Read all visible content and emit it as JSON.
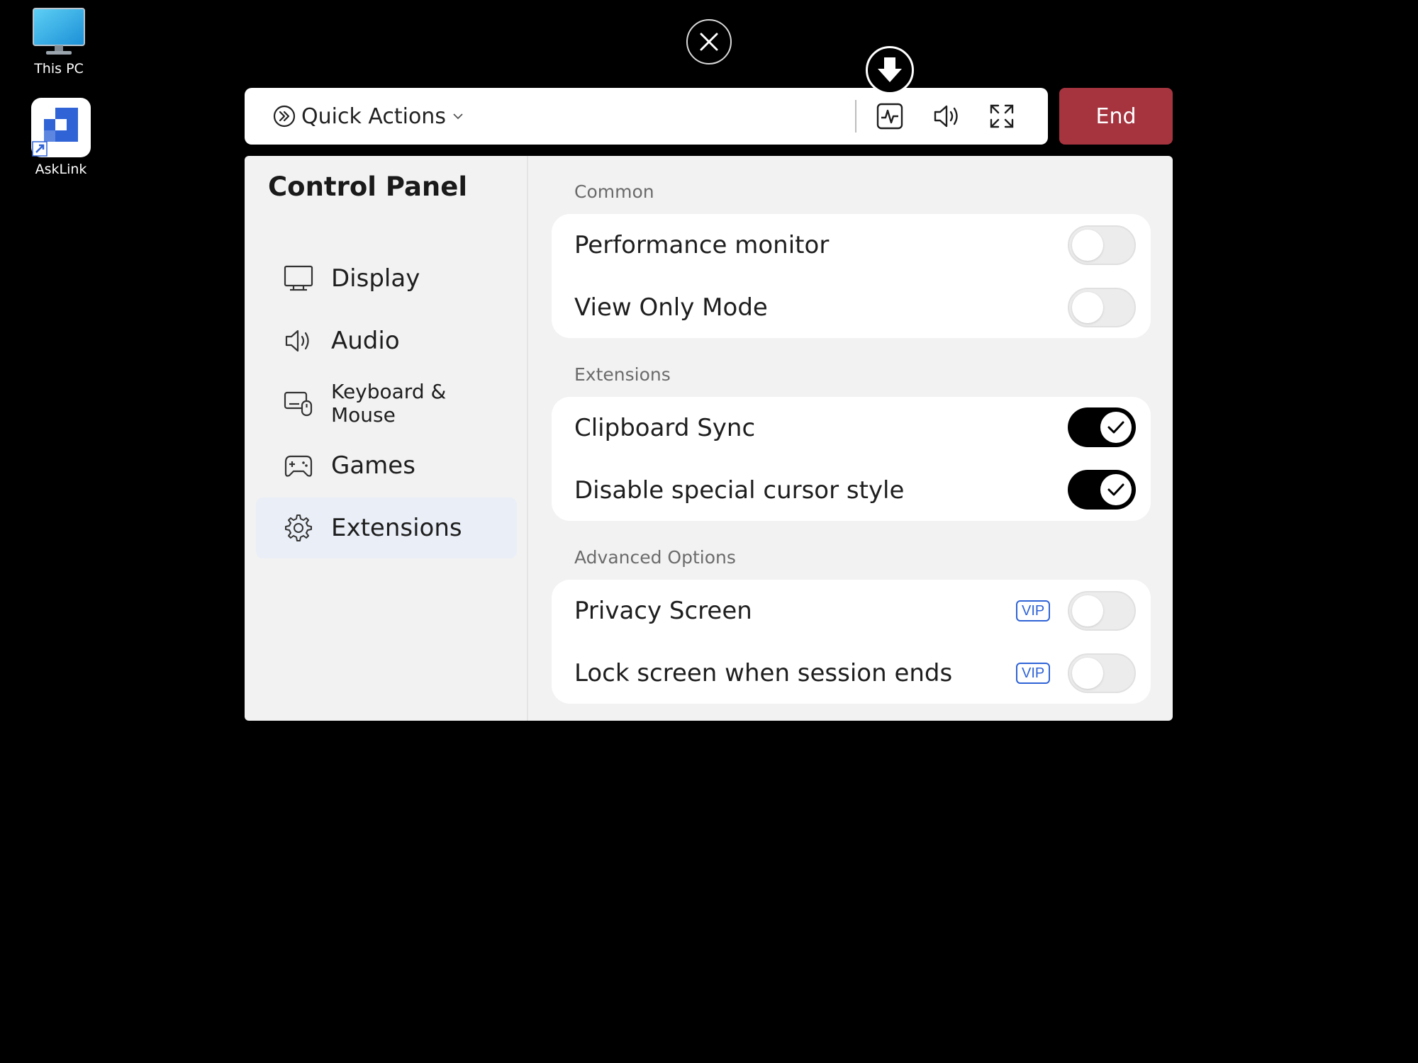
{
  "desktop": {
    "icons": [
      {
        "label": "This PC",
        "icon": "monitor-icon"
      },
      {
        "label": "AskLink",
        "icon": "asklink-app-icon"
      }
    ]
  },
  "toolbar": {
    "quick_actions_label": "Quick Actions",
    "end_label": "End",
    "buttons": [
      "performance-monitor-icon",
      "audio-icon",
      "fullscreen-icon"
    ]
  },
  "panel": {
    "title": "Control Panel",
    "nav": [
      {
        "label": "Display",
        "icon": "monitor-icon",
        "active": false
      },
      {
        "label": "Audio",
        "icon": "speaker-icon",
        "active": false
      },
      {
        "label": "Keyboard & Mouse",
        "icon": "keyboard-mouse-icon",
        "active": false
      },
      {
        "label": "Games",
        "icon": "gamepad-icon",
        "active": false
      },
      {
        "label": "Extensions",
        "icon": "gear-icon",
        "active": true
      }
    ],
    "sections": [
      {
        "title": "Common",
        "rows": [
          {
            "label": "Performance monitor",
            "enabled": false
          },
          {
            "label": "View Only Mode",
            "enabled": false
          }
        ]
      },
      {
        "title": "Extensions",
        "rows": [
          {
            "label": "Clipboard Sync",
            "enabled": true
          },
          {
            "label": "Disable special cursor style",
            "enabled": true
          }
        ]
      },
      {
        "title": "Advanced Options",
        "rows": [
          {
            "label": "Privacy Screen",
            "enabled": false,
            "badge": "VIP"
          },
          {
            "label": "Lock screen when session ends",
            "enabled": false,
            "badge": "VIP"
          }
        ]
      }
    ]
  },
  "colors": {
    "end_button": "#a5343f",
    "vip_badge": "#2f63d6",
    "active_nav": "#e9eef7"
  }
}
